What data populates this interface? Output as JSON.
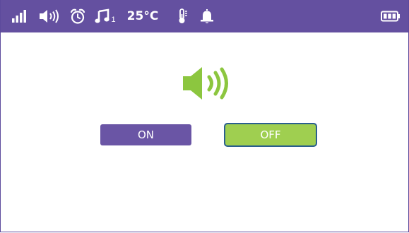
{
  "status_bar": {
    "temperature": "25°C",
    "music_track_number": "1",
    "icons": [
      "signal-icon",
      "volume-icon",
      "alarm-clock-icon",
      "music-note-icon",
      "thermometer-icon",
      "bell-icon",
      "battery-icon"
    ]
  },
  "sound_control": {
    "icon": "speaker-icon",
    "on_label": "ON",
    "off_label": "OFF",
    "selected": "OFF"
  },
  "colors": {
    "status_bar": "#6450a0",
    "on_button": "#6a55a5",
    "off_button": "#9fcf50",
    "off_button_border": "#2a5f8e",
    "speaker": "#8cc63f"
  }
}
